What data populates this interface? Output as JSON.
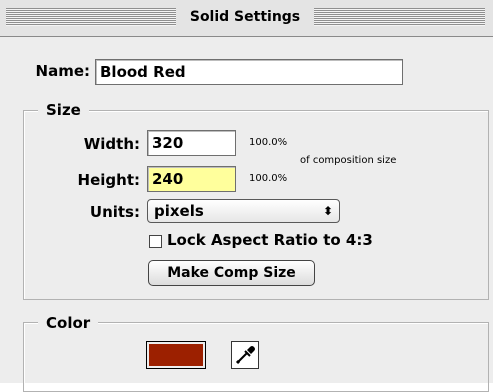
{
  "window": {
    "title": "Solid Settings"
  },
  "name": {
    "label": "Name:",
    "value": "Blood Red"
  },
  "size": {
    "group_title": "Size",
    "width_label": "Width:",
    "width_value": "320",
    "width_percent": "100.0%",
    "height_label": "Height:",
    "height_value": "240",
    "height_percent": "100.0%",
    "composition_note": "of composition size",
    "units_label": "Units:",
    "units_value": "pixels",
    "lock_aspect_label": "Lock Aspect Ratio to 4:3",
    "lock_aspect_checked": false,
    "make_comp_size_label": "Make Comp Size"
  },
  "color": {
    "group_title": "Color",
    "swatch_color": "#9c2000",
    "eyedropper_icon": "eyedropper-icon"
  },
  "colors": {
    "window_bg": "#ededed",
    "highlight_field": "#ffff9c"
  }
}
